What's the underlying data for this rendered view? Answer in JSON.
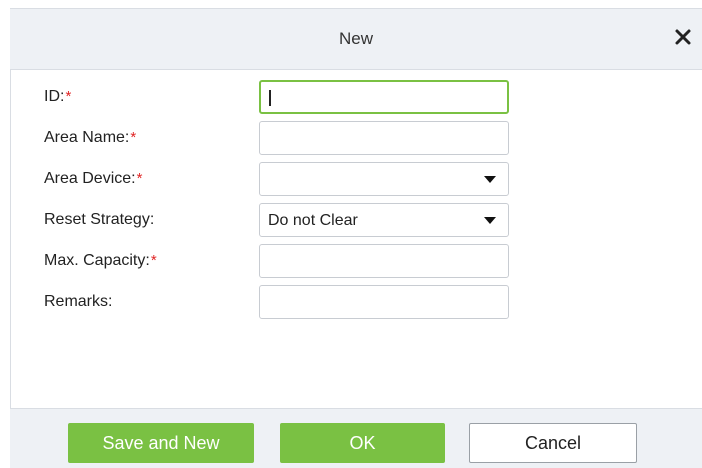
{
  "dialog": {
    "title": "New"
  },
  "form": {
    "fields": [
      {
        "label": "ID:",
        "required_mark": "*",
        "value": "",
        "type": "text"
      },
      {
        "label": "Area Name:",
        "required_mark": "*",
        "value": "",
        "type": "text"
      },
      {
        "label": "Area Device:",
        "required_mark": "*",
        "value": "",
        "type": "select"
      },
      {
        "label": "Reset Strategy:",
        "required_mark": "",
        "value": "Do not Clear",
        "type": "select"
      },
      {
        "label": "Max. Capacity:",
        "required_mark": "*",
        "value": "",
        "type": "text"
      },
      {
        "label": "Remarks:",
        "required_mark": "",
        "value": "",
        "type": "text"
      }
    ]
  },
  "footer": {
    "save_new_label": "Save and New",
    "ok_label": "OK",
    "cancel_label": "Cancel"
  },
  "icons": {
    "close": "close-icon",
    "dropdown": "chevron-down-icon"
  },
  "colors": {
    "accent_green": "#7ac143",
    "required_red": "#e02424",
    "header_bg": "#eef1f5"
  }
}
